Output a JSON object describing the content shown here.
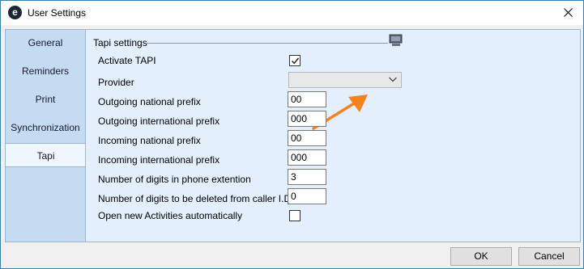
{
  "window": {
    "app_icon": "e",
    "title": "User Settings",
    "close_icon": "close-icon"
  },
  "sidebar": {
    "items": [
      {
        "label": "General",
        "active": false
      },
      {
        "label": "Reminders",
        "active": false
      },
      {
        "label": "Print",
        "active": false
      },
      {
        "label": "Synchronization",
        "active": false
      },
      {
        "label": "Tapi",
        "active": true
      }
    ]
  },
  "tapi": {
    "group_title": "Tapi settings",
    "group_icon": "computer-phone-icon",
    "activate_label": "Activate TAPI",
    "activate_checked": true,
    "provider_label": "Provider",
    "provider_value": "",
    "outgoing_national_label": "Outgoing national prefix",
    "outgoing_national_value": "00",
    "outgoing_international_label": "Outgoing international prefix",
    "outgoing_international_value": "000",
    "incoming_national_label": "Incoming national prefix",
    "incoming_national_value": "00",
    "incoming_international_label": "Incoming international prefix",
    "incoming_international_value": "000",
    "digits_extension_label": "Number of digits in phone extention",
    "digits_extension_value": "3",
    "digits_deleted_label": "Number of digits to be deleted from caller I.D.",
    "digits_deleted_value": "0",
    "open_activities_label": "Open new Activities automatically",
    "open_activities_checked": false
  },
  "annotation": {
    "arrow_color": "#f5821f"
  },
  "footer": {
    "ok_label": "OK",
    "cancel_label": "Cancel"
  }
}
